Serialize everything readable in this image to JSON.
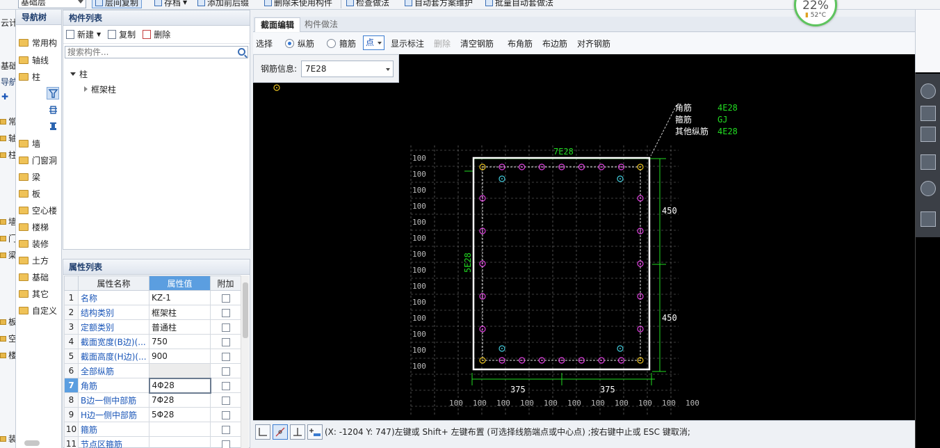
{
  "toolbar": {
    "floor_select": "基础层",
    "items": [
      "层间复制",
      "存档",
      "添加前后缀",
      "删除未使用构件",
      "检查做法",
      "自动套方案维护",
      "批量自动套做法"
    ]
  },
  "far_left": {
    "rows": [
      "云计",
      "基础",
      "导航",
      "✚",
      "常",
      "轴",
      "柱",
      "墙",
      "门",
      "梁",
      "板",
      "空",
      "楼",
      "装"
    ]
  },
  "nav_tree": {
    "title": "导航树",
    "items": [
      "常用构",
      "轴线",
      "柱",
      "墙",
      "门窗洞",
      "梁",
      "板",
      "空心楼",
      "楼梯",
      "装修",
      "土方",
      "基础",
      "其它",
      "自定义"
    ]
  },
  "component_list": {
    "title": "构件列表",
    "new_label": "新建",
    "copy_label": "复制",
    "delete_label": "删除",
    "search_placeholder": "搜索构件...",
    "tree_root": "柱",
    "tree_child": "框架柱"
  },
  "property_list": {
    "title": "属性列表",
    "headers": [
      "属性名称",
      "属性值",
      "附加"
    ],
    "rows": [
      {
        "no": "1",
        "name": "名称",
        "value": "KZ-1"
      },
      {
        "no": "2",
        "name": "结构类别",
        "value": "框架柱"
      },
      {
        "no": "3",
        "name": "定额类别",
        "value": "普通柱"
      },
      {
        "no": "4",
        "name": "截面宽度(B边)(...",
        "value": "750"
      },
      {
        "no": "5",
        "name": "截面高度(H边)(...",
        "value": "900"
      },
      {
        "no": "6",
        "name": "全部纵筋",
        "value": ""
      },
      {
        "no": "7",
        "name": "角筋",
        "value": "4Φ28"
      },
      {
        "no": "8",
        "name": "B边一侧中部筋",
        "value": "7Φ28"
      },
      {
        "no": "9",
        "name": "H边一侧中部筋",
        "value": "5Φ28"
      },
      {
        "no": "10",
        "name": "箍筋",
        "value": ""
      },
      {
        "no": "11",
        "name": "节点区箍筋",
        "value": ""
      }
    ]
  },
  "main_tabs": {
    "active": "截面编辑",
    "inactive": "构件做法"
  },
  "main_tools": {
    "select": "选择",
    "longitudinal": "纵筋",
    "stirrup": "箍筋",
    "point": "点",
    "show_mark": "显示标注",
    "delete": "删除",
    "clear": "清空钢筋",
    "corner": "布角筋",
    "edge": "布边筋",
    "align": "对齐钢筋"
  },
  "rebar_info": {
    "label": "钢筋信息:",
    "value": "7E28"
  },
  "drawing": {
    "legend_labels": [
      "角筋",
      "箍筋",
      "其他纵筋"
    ],
    "legend_values": [
      "4E28",
      "GJ",
      "4E28"
    ],
    "top_label": "7E28",
    "left_label": "5E28",
    "dim_right": [
      "450",
      "450"
    ],
    "dim_bottom": [
      "375",
      "375"
    ],
    "grid_label": "100",
    "colors": {
      "outline": "#ffffff",
      "green": "#22dd22",
      "magenta": "#e040e0",
      "yellow": "#e8c020",
      "cyan": "#40c8d8",
      "grid": "#808080"
    }
  },
  "status": {
    "text": "(X: -1204 Y: 747)左键或 Shift+ 左键布置 (可选择线筋端点或中心点) ;按右键中止或 ESC 键取消;"
  },
  "cpu": {
    "percent": "22%",
    "temp": "52°C"
  }
}
